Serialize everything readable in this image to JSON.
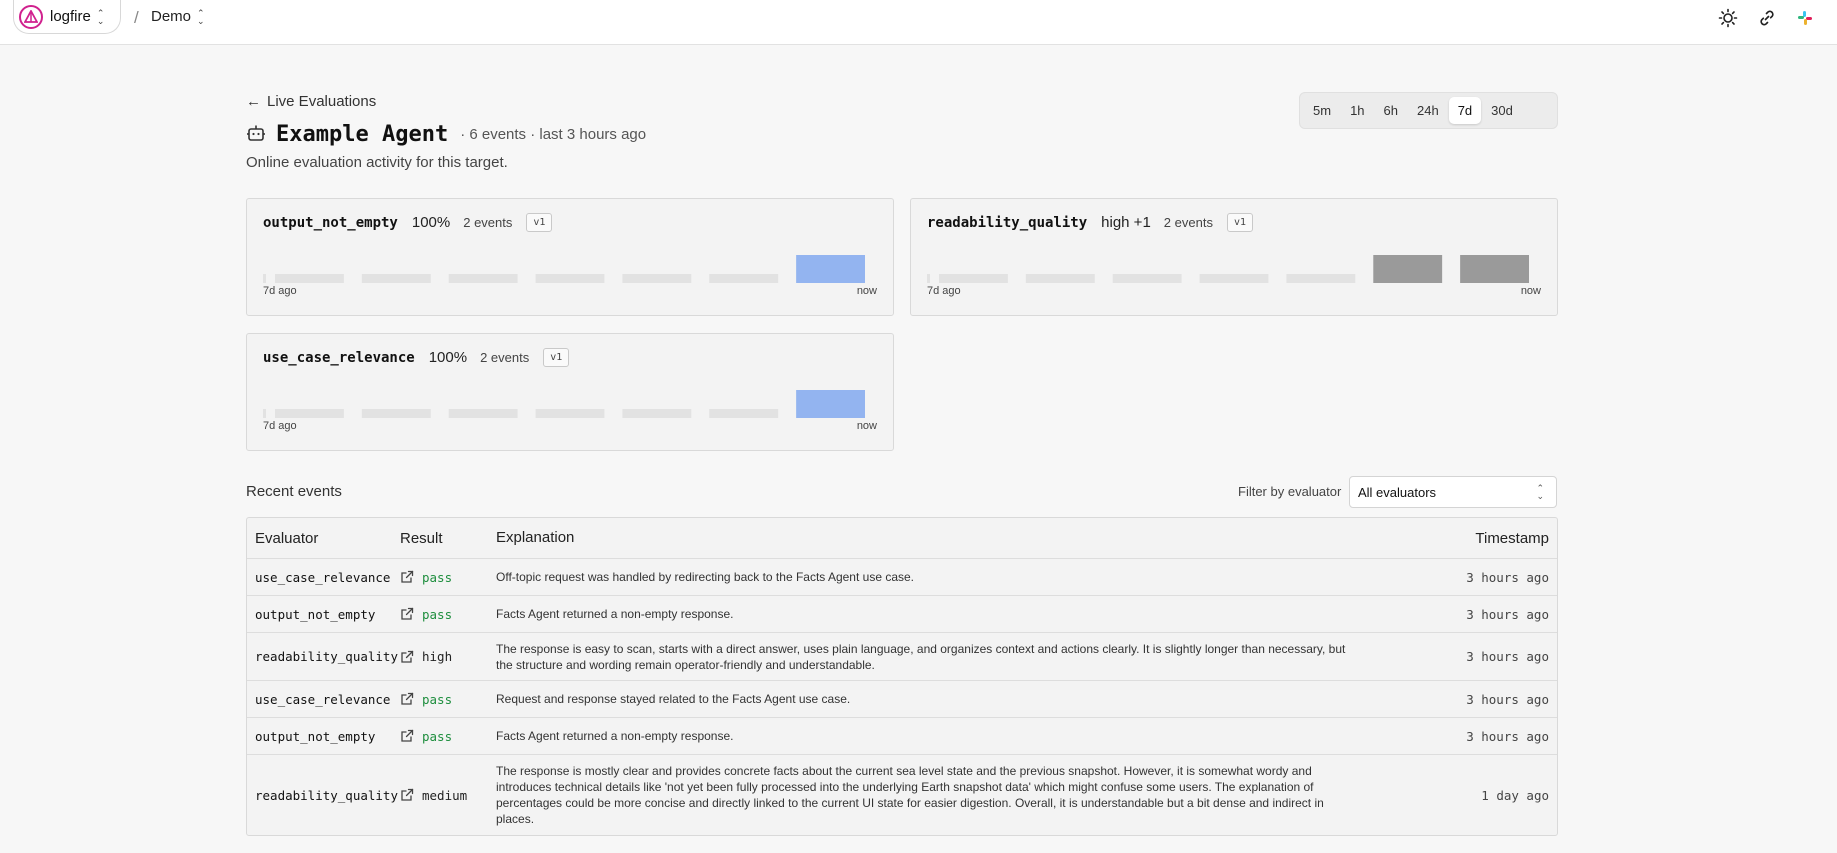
{
  "topbar": {
    "org_name": "logfire",
    "separator": "/",
    "project_name": "Demo",
    "icons": [
      "theme-toggle-icon",
      "link-icon",
      "slack-icon"
    ]
  },
  "header": {
    "back_label": "Live Evaluations",
    "title": "Example Agent",
    "meta": "· 6 events · last 3 hours ago",
    "subtitle": "Online evaluation activity for this target."
  },
  "time_ranges": {
    "options": [
      "5m",
      "1h",
      "6h",
      "24h",
      "7d",
      "30d"
    ],
    "selected": "7d"
  },
  "cards": [
    {
      "name": "output_not_empty",
      "score": "100%",
      "events": "2 events",
      "version": "v1",
      "left_label": "7d ago",
      "right_label": "now",
      "bar_color": "#93b4f0",
      "buckets": [
        0,
        0,
        0,
        0,
        0,
        0,
        2
      ]
    },
    {
      "name": "readability_quality",
      "score": "high +1",
      "events": "2 events",
      "version": "v1",
      "left_label": "7d ago",
      "right_label": "now",
      "bar_color": "#9a9a9a",
      "buckets": [
        0,
        0,
        0,
        0,
        0,
        1,
        1
      ]
    },
    {
      "name": "use_case_relevance",
      "score": "100%",
      "events": "2 events",
      "version": "v1",
      "left_label": "7d ago",
      "right_label": "now",
      "bar_color": "#93b4f0",
      "buckets": [
        0,
        0,
        0,
        0,
        0,
        0,
        2
      ]
    }
  ],
  "recent": {
    "title": "Recent events",
    "filter_label": "Filter by evaluator",
    "filter_value": "All evaluators",
    "columns": [
      "Evaluator",
      "Result",
      "Explanation",
      "Timestamp"
    ],
    "rows": [
      {
        "evaluator": "use_case_relevance",
        "result": "pass",
        "explanation": "Off-topic request was handled by redirecting back to the Facts Agent use case.",
        "timestamp": "3 hours ago"
      },
      {
        "evaluator": "output_not_empty",
        "result": "pass",
        "explanation": "Facts Agent returned a non-empty response.",
        "timestamp": "3 hours ago"
      },
      {
        "evaluator": "readability_quality",
        "result": "high",
        "explanation": "The response is easy to scan, starts with a direct answer, uses plain language, and organizes context and actions clearly. It is slightly longer than necessary, but the structure and wording remain operator-friendly and understandable.",
        "timestamp": "3 hours ago"
      },
      {
        "evaluator": "use_case_relevance",
        "result": "pass",
        "explanation": "Request and response stayed related to the Facts Agent use case.",
        "timestamp": "3 hours ago"
      },
      {
        "evaluator": "output_not_empty",
        "result": "pass",
        "explanation": "Facts Agent returned a non-empty response.",
        "timestamp": "3 hours ago"
      },
      {
        "evaluator": "readability_quality",
        "result": "medium",
        "explanation": "The response is mostly clear and provides concrete facts about the current sea level state and the previous snapshot. However, it is somewhat wordy and introduces technical details like 'not yet been fully processed into the underlying Earth snapshot data' which might confuse some users. The explanation of percentages could be more concise and directly linked to the current UI state for easier digestion. Overall, it is understandable but a bit dense and indirect in places.",
        "timestamp": "1 day ago"
      }
    ]
  },
  "colors": {
    "pass": "#1e8e3e",
    "brand": "#d0218e",
    "empty_bucket": "#e2e2e2"
  }
}
